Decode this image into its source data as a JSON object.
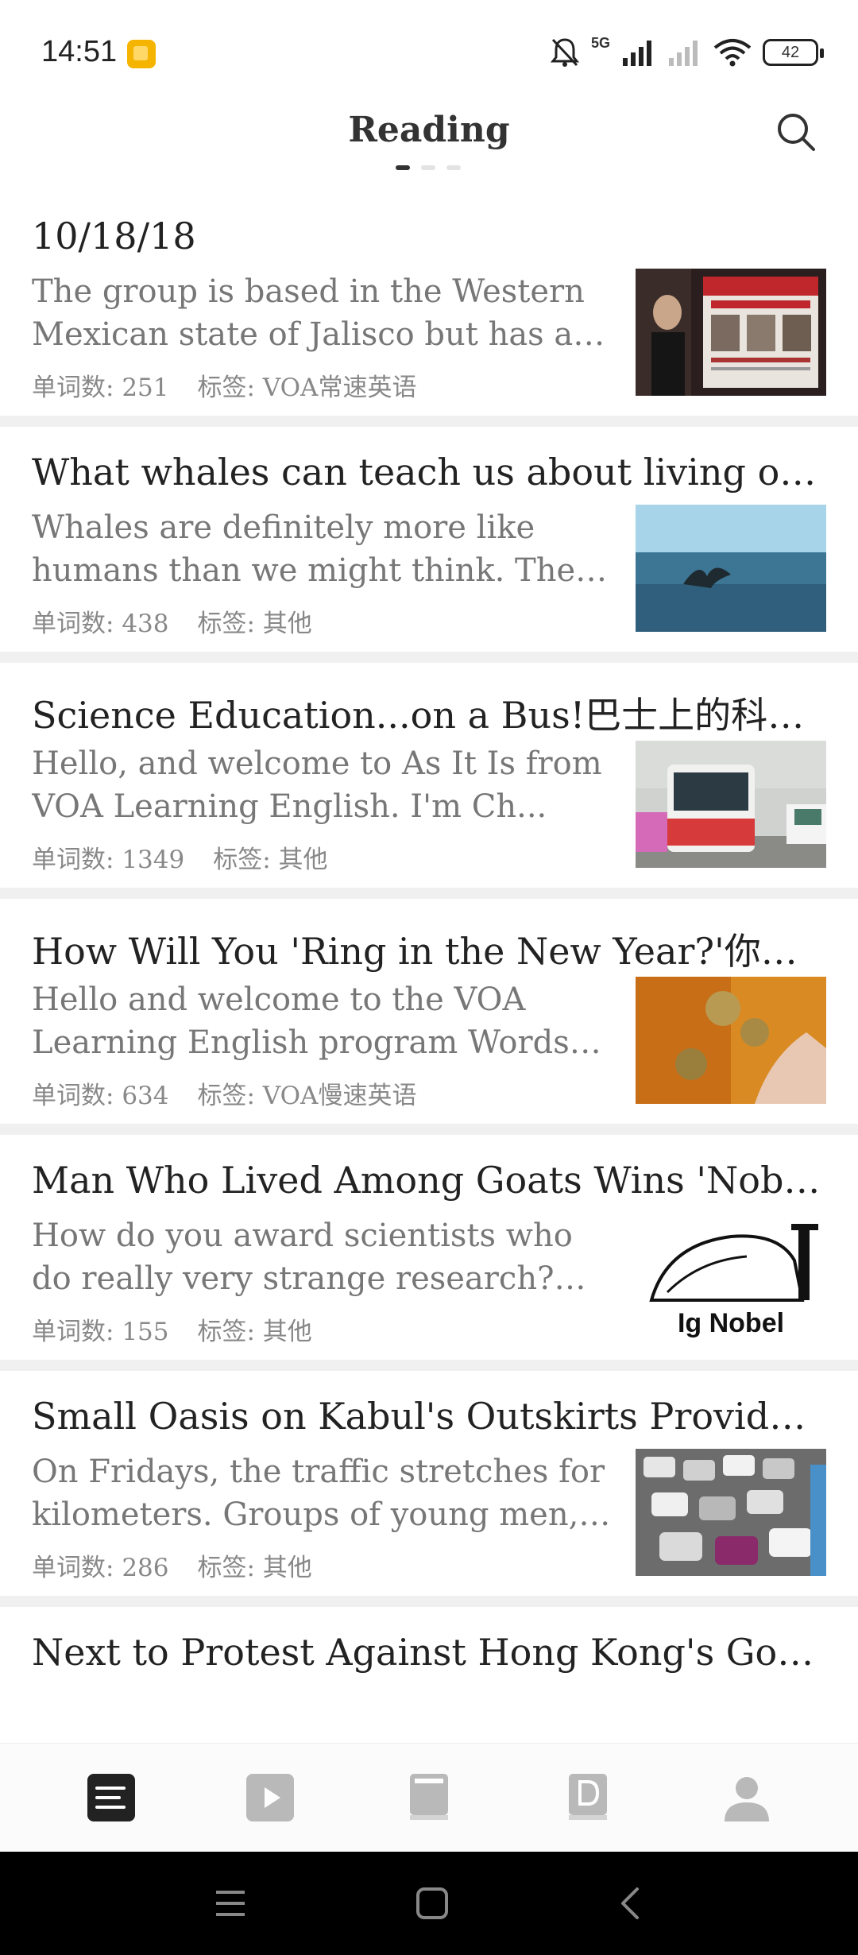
{
  "status_bar": {
    "time": "14:51",
    "network": "5G",
    "battery": "42"
  },
  "header": {
    "title": "Reading"
  },
  "meta_labels": {
    "word_count": "单词数: ",
    "tag": "标签: "
  },
  "articles": [
    {
      "title": "10/18/18",
      "summary": "The group is based in the Western Mexican state of Jalisco but has a n...",
      "word_count": "251",
      "tag": "VOA常速英语",
      "thumb": "reward-poster-image"
    },
    {
      "title": "What whales can teach us about living our...",
      "summary": "Whales are definitely more like humans than we might think. They ...",
      "word_count": "438",
      "tag": "其他",
      "thumb": "whale-tail-image"
    },
    {
      "title": "Science Education...on a Bus!巴士上的科学...",
      "summary": "Hello, and welcome to As It Is from VOA Learning English. I'm Ch...",
      "word_count": "1349",
      "tag": "其他",
      "thumb": "science-bus-image"
    },
    {
      "title": "How Will You 'Ring in the New Year?'你将...",
      "summary": "Hello and welcome to the VOA Learning English program Words a...",
      "word_count": "634",
      "tag": "VOA慢速英语",
      "thumb": "bells-image"
    },
    {
      "title": "Man Who Lived Among Goats Wins 'Nobel'...",
      "summary": "How do you award scientists who do really very strange research? Gl...",
      "word_count": "155",
      "tag": "其他",
      "thumb": "ig-nobel-image",
      "thumb_text": "Ig Nobel"
    },
    {
      "title": "Small Oasis on Kabul's Outskirts Provides ...",
      "summary": "On Fridays, the traffic stretches for kilometers. Groups of young men, c...",
      "word_count": "286",
      "tag": "其他",
      "thumb": "traffic-image"
    },
    {
      "title": "Next to Protest Against Hong Kong's Gover...",
      "summary": "",
      "word_count": "",
      "tag": ""
    }
  ],
  "tabs": [
    {
      "name": "tab-reading",
      "icon": "list-icon",
      "active": true
    },
    {
      "name": "tab-video",
      "icon": "play-icon",
      "active": false
    },
    {
      "name": "tab-book",
      "icon": "book-icon",
      "active": false
    },
    {
      "name": "tab-dictionary",
      "icon": "dictionary-icon",
      "active": false
    },
    {
      "name": "tab-profile",
      "icon": "person-icon",
      "active": false
    }
  ]
}
